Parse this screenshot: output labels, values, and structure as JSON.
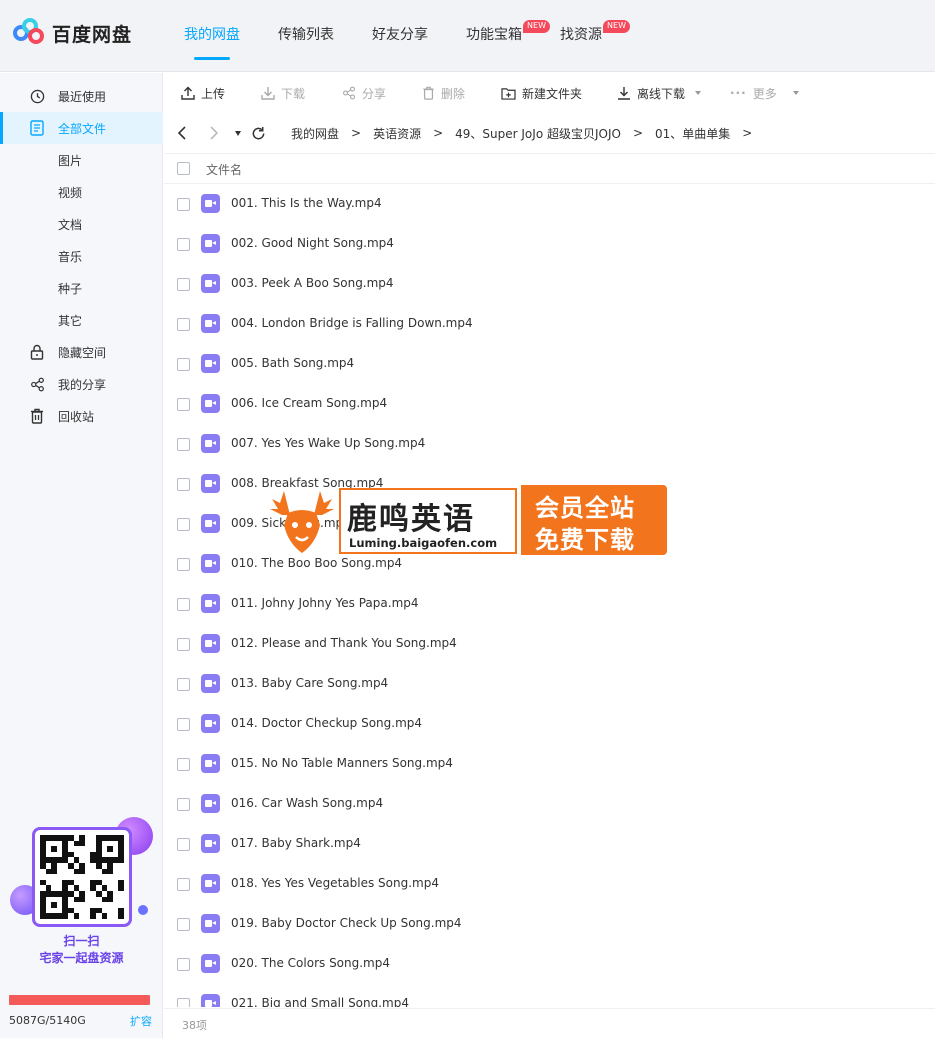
{
  "app": {
    "logo_text": "百度网盘",
    "brand_colors": {
      "accent": "#06a7ff",
      "logo_blue": "#3d8af7",
      "logo_cyan": "#38d0e8",
      "logo_red": "#f4495a"
    }
  },
  "nav": [
    {
      "label": "我的网盘",
      "active": true
    },
    {
      "label": "传输列表"
    },
    {
      "label": "好友分享"
    },
    {
      "label": "功能宝箱",
      "badge": "NEW"
    },
    {
      "label": "找资源",
      "badge": "NEW"
    }
  ],
  "sidebar": {
    "items": [
      {
        "label": "最近使用",
        "icon": "clock-icon"
      },
      {
        "label": "全部文件",
        "icon": "document-icon",
        "active": true
      },
      {
        "label": "图片"
      },
      {
        "label": "视频"
      },
      {
        "label": "文档"
      },
      {
        "label": "音乐"
      },
      {
        "label": "种子"
      },
      {
        "label": "其它"
      },
      {
        "label": "隐藏空间",
        "icon": "lock-icon"
      },
      {
        "label": "我的分享",
        "icon": "share-icon"
      },
      {
        "label": "回收站",
        "icon": "trash-icon"
      }
    ],
    "promo": {
      "line1": "扫一扫",
      "line2": "宅家一起盘资源"
    },
    "storage": {
      "text": "5087G/5140G",
      "expand": "扩容",
      "used_fraction": 0.99,
      "bar_color": "#f55a5a"
    }
  },
  "toolbar": {
    "upload": "上传",
    "download": "下载",
    "share": "分享",
    "delete": "删除",
    "new_folder": "新建文件夹",
    "offline_download": "离线下载",
    "more": "更多"
  },
  "breadcrumb": [
    "我的网盘",
    "英语资源",
    "49、Super JoJo 超级宝贝JOJO",
    "01、单曲单集"
  ],
  "file_header": {
    "name": "文件名"
  },
  "files": [
    "001. This Is the Way.mp4",
    "002. Good Night Song.mp4",
    "003. Peek A Boo Song.mp4",
    "004. London Bridge is Falling Down.mp4",
    "005. Bath Song.mp4",
    "006. Ice Cream Song.mp4",
    "007. Yes Yes Wake Up Song.mp4",
    "008. Breakfast Song.mp4",
    "009. Sick Song.mp4",
    "010. The Boo Boo Song.mp4",
    "011. Johny Johny Yes Papa.mp4",
    "012. Please and Thank You Song.mp4",
    "013. Baby Care Song.mp4",
    "014. Doctor Checkup Song.mp4",
    "015. No No Table Manners Song.mp4",
    "016. Car Wash Song.mp4",
    "017. Baby Shark.mp4",
    "018. Yes Yes Vegetables Song.mp4",
    "019. Baby Doctor Check Up Song.mp4",
    "020. The Colors Song.mp4",
    "021. Big and Small Song.mp4"
  ],
  "footer": {
    "count": "38项"
  },
  "watermark": {
    "name": "鹿鸣英语",
    "url": "Luming.baigaofen.com",
    "tag_line1": "会员全站",
    "tag_line2": "免费下载"
  }
}
